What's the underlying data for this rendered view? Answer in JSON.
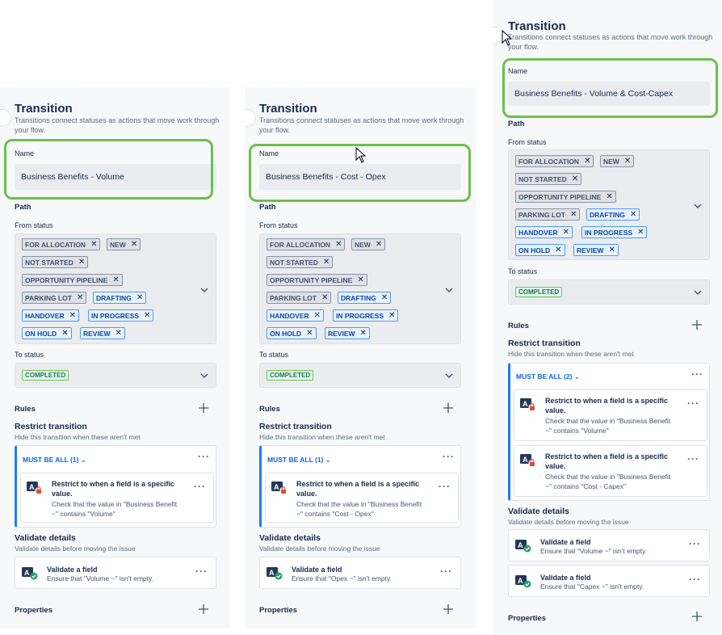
{
  "panels": [
    {
      "title": "Transition",
      "subtitle": "Transitions connect statuses as actions that move work through your flow.",
      "name_label": "Name",
      "name_value": "Business Benefits - Volume",
      "path_label": "Path",
      "from_label": "From status",
      "from_statuses": [
        {
          "label": "FOR ALLOCATION",
          "style": "gray"
        },
        {
          "label": "NEW",
          "style": "gray"
        },
        {
          "label": "NOT STARTED",
          "style": "gray"
        },
        {
          "label": "OPPORTUNITY PIPELINE",
          "style": "gray"
        },
        {
          "label": "PARKING LOT",
          "style": "gray"
        },
        {
          "label": "DRAFTING",
          "style": "blue"
        },
        {
          "label": "HANDOVER",
          "style": "blue"
        },
        {
          "label": "IN PROGRESS",
          "style": "blue"
        },
        {
          "label": "ON HOLD",
          "style": "blue"
        },
        {
          "label": "REVIEW",
          "style": "blue"
        }
      ],
      "to_label": "To status",
      "to_status": "COMPLETED",
      "rules_label": "Rules",
      "restrict_title": "Restrict transition",
      "restrict_sub": "Hide this transition when these aren't met",
      "must_be": "MUST BE ALL (1)",
      "restrictions": [
        {
          "title_line1": "Restrict to when a field is a specific",
          "title_line2": "value.",
          "desc_line1": "Check that the value in \"Business Benefit",
          "desc_line2": "~\" contains \"Volume\""
        }
      ],
      "validate_title": "Validate details",
      "validate_sub": "Validate details before moving the issue",
      "validators": [
        {
          "title": "Validate a field",
          "desc": "Ensure that \"Volume ~\" isn't empty."
        }
      ],
      "properties_label": "Properties"
    },
    {
      "title": "Transition",
      "subtitle": "Transitions connect statuses as actions that move work through your flow.",
      "name_label": "Name",
      "name_value": "Business Benefits - Cost - Opex",
      "path_label": "Path",
      "from_label": "From status",
      "from_statuses": [
        {
          "label": "FOR ALLOCATION",
          "style": "gray"
        },
        {
          "label": "NEW",
          "style": "gray"
        },
        {
          "label": "NOT STARTED",
          "style": "gray"
        },
        {
          "label": "OPPORTUNITY PIPELINE",
          "style": "gray"
        },
        {
          "label": "PARKING LOT",
          "style": "gray"
        },
        {
          "label": "DRAFTING",
          "style": "blue"
        },
        {
          "label": "HANDOVER",
          "style": "blue"
        },
        {
          "label": "IN PROGRESS",
          "style": "blue"
        },
        {
          "label": "ON HOLD",
          "style": "blue"
        },
        {
          "label": "REVIEW",
          "style": "blue"
        }
      ],
      "to_label": "To status",
      "to_status": "COMPLETED",
      "rules_label": "Rules",
      "restrict_title": "Restrict transition",
      "restrict_sub": "Hide this transition when these aren't met",
      "must_be": "MUST BE ALL (1)",
      "restrictions": [
        {
          "title_line1": "Restrict to when a field is a specific",
          "title_line2": "value.",
          "desc_line1": "Check that the value in \"Business Benefit",
          "desc_line2": "~\" contains \"Cost - Opex\""
        }
      ],
      "validate_title": "Validate details",
      "validate_sub": "Validate details before moving the issue",
      "validators": [
        {
          "title": "Validate a field",
          "desc": "Ensure that \"Opex ~\" isn't empty."
        }
      ],
      "properties_label": "Properties"
    },
    {
      "title": "Transition",
      "subtitle": "Transitions connect statuses as actions that move work through your flow.",
      "name_label": "Name",
      "name_value": "Business Benefits - Volume & Cost-Capex",
      "path_label": "Path",
      "from_label": "From status",
      "from_statuses": [
        {
          "label": "FOR ALLOCATION",
          "style": "gray"
        },
        {
          "label": "NEW",
          "style": "gray"
        },
        {
          "label": "NOT STARTED",
          "style": "gray"
        },
        {
          "label": "OPPORTUNITY PIPELINE",
          "style": "gray"
        },
        {
          "label": "PARKING LOT",
          "style": "gray"
        },
        {
          "label": "DRAFTING",
          "style": "blue"
        },
        {
          "label": "HANDOVER",
          "style": "blue"
        },
        {
          "label": "IN PROGRESS",
          "style": "blue"
        },
        {
          "label": "ON HOLD",
          "style": "blue"
        },
        {
          "label": "REVIEW",
          "style": "blue"
        }
      ],
      "to_label": "To status",
      "to_status": "COMPLETED",
      "rules_label": "Rules",
      "restrict_title": "Restrict transition",
      "restrict_sub": "Hide this transition when these aren't met",
      "must_be": "MUST BE ALL (2)",
      "restrictions": [
        {
          "title_line1": "Restrict to when a field is a specific",
          "title_line2": "value.",
          "desc_line1": "Check that the value in \"Business Benefit",
          "desc_line2": "~\" contains \"Volume\""
        },
        {
          "title_line1": "Restrict to when a field is a specific",
          "title_line2": "value.",
          "desc_line1": "Check that the value in \"Business Benefit",
          "desc_line2": "~\" contains \"Cost - Capex\""
        }
      ],
      "validate_title": "Validate details",
      "validate_sub": "Validate details before moving the issue",
      "validators": [
        {
          "title": "Validate a field",
          "desc": "Ensure that \"Volume ~\" isn't empty."
        },
        {
          "title": "Validate a field",
          "desc": "Ensure that \"Capex ~\" isn't empty."
        }
      ],
      "properties_label": "Properties"
    }
  ],
  "colors": {
    "highlight": "#6cc04a",
    "accent": "#0c66e4",
    "completed_bg": "#e3fcef"
  }
}
